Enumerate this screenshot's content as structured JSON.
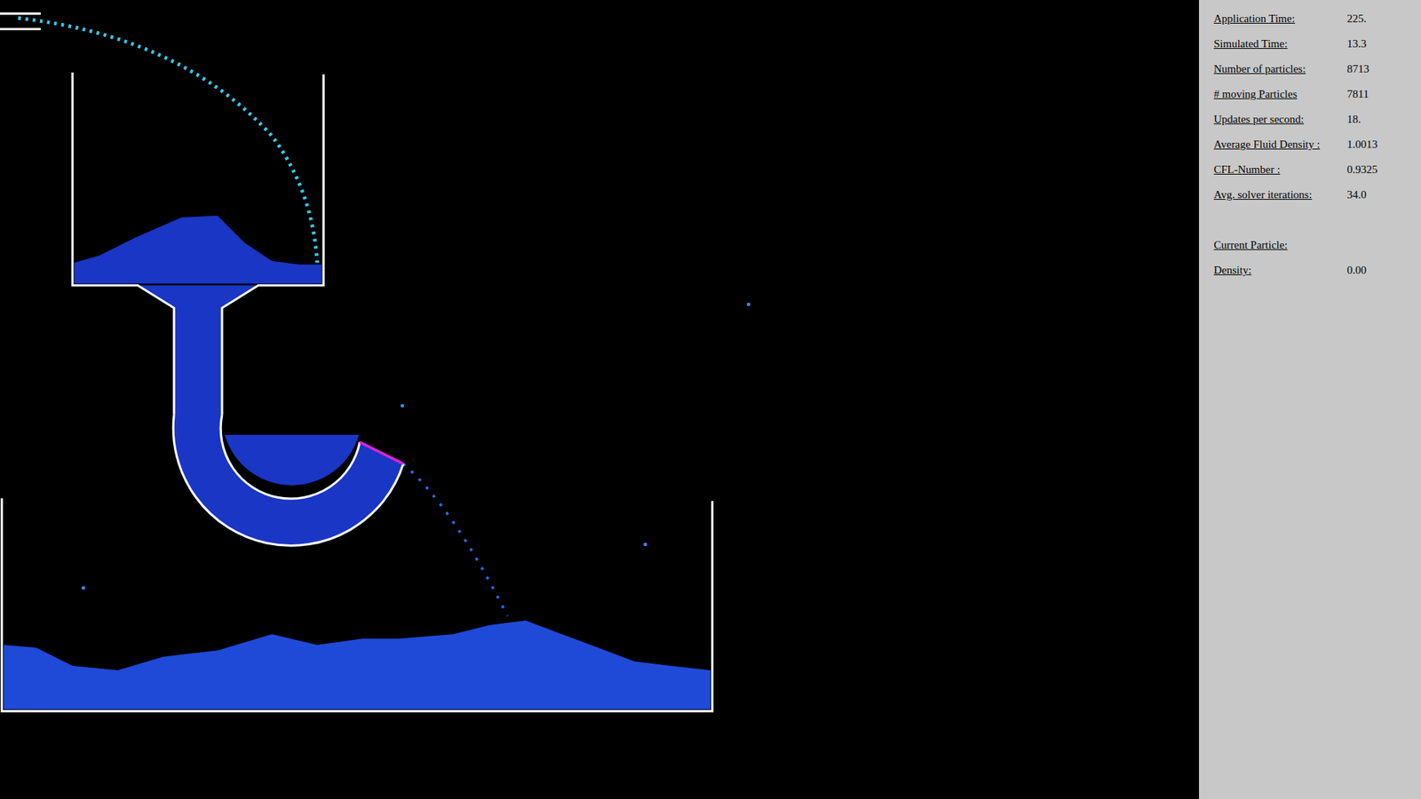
{
  "stats": [
    {
      "label": "Application Time:",
      "value": "225."
    },
    {
      "label": "Simulated Time:",
      "value": "13.3"
    },
    {
      "label": "Number of particles:",
      "value": "8713"
    },
    {
      "label": "# moving Particles",
      "value": "7811"
    },
    {
      "label": "Updates per second:",
      "value": "18."
    },
    {
      "label": "Average Fluid Density :",
      "value": "1.0013"
    },
    {
      "label": "CFL-Number :",
      "value": "0.9325"
    },
    {
      "label": "Avg. solver iterations:",
      "value": "34.0"
    }
  ],
  "current_particle": {
    "title": "Current Particle:",
    "rows": [
      {
        "label": "Density:",
        "value": "0.00"
      }
    ]
  }
}
